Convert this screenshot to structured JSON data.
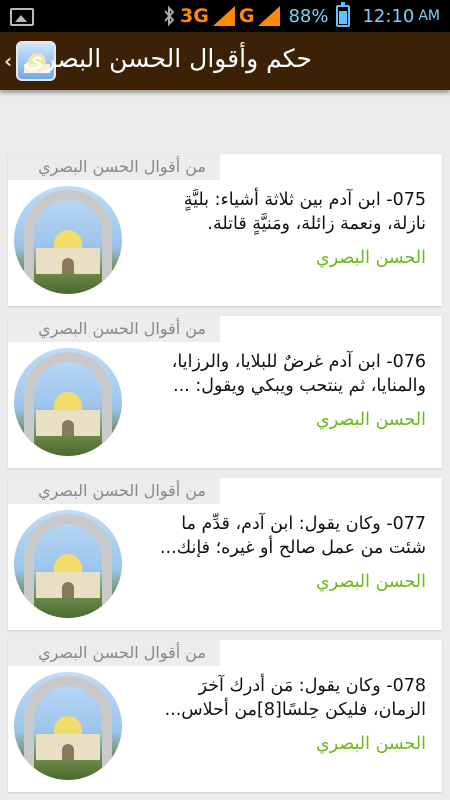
{
  "status_bar": {
    "gallery_icon": "image-icon",
    "bluetooth_icon": "bluetooth-icon",
    "network1": "3G",
    "network2": "G",
    "battery_pct": "88%",
    "battery_level": 0.88,
    "time": "12:10",
    "ampm": "AM",
    "colors": {
      "network": "#ff8a00",
      "battery": "#5cc3ff"
    }
  },
  "app_bar": {
    "back_icon": "chevron-left-icon",
    "app_icon": "mosque-app-icon",
    "title": "حكم وأقوال الحسن البصري",
    "color": "#3c2107"
  },
  "cards": [
    {
      "tag": "من أقوال الحسن البصري",
      "line1": "075-  ابن آدم بين ثلاثة أشياء: بليَّةٍ",
      "line2": "نازلة، ونعمة زائلة، ومَنيَّةٍ قاتلة.",
      "author": "الحسن البصري"
    },
    {
      "tag": "من أقوال الحسن البصري",
      "line1": "076- ابن آدم غرضٌ للبلايا، والرزايا،",
      "line2": "والمنايا، ثم ينتحب ويبكي ويقول: ...",
      "author": "الحسن البصري"
    },
    {
      "tag": "من أقوال الحسن البصري",
      "line1": "077- وكان يقول: ابن آدم، قدِّم ما",
      "line2": "شئت من عمل صالح أو غيره؛ فإنك...",
      "author": "الحسن البصري"
    },
    {
      "tag": "من أقوال الحسن البصري",
      "line1": "078- وكان يقول: مَن أدرك آخرَ",
      "line2": "الزمان، فليكن حِلسًا[8]من أحلاس...",
      "author": "الحسن البصري"
    }
  ],
  "colors": {
    "author": "#6cb819",
    "tag_text": "#888888"
  }
}
